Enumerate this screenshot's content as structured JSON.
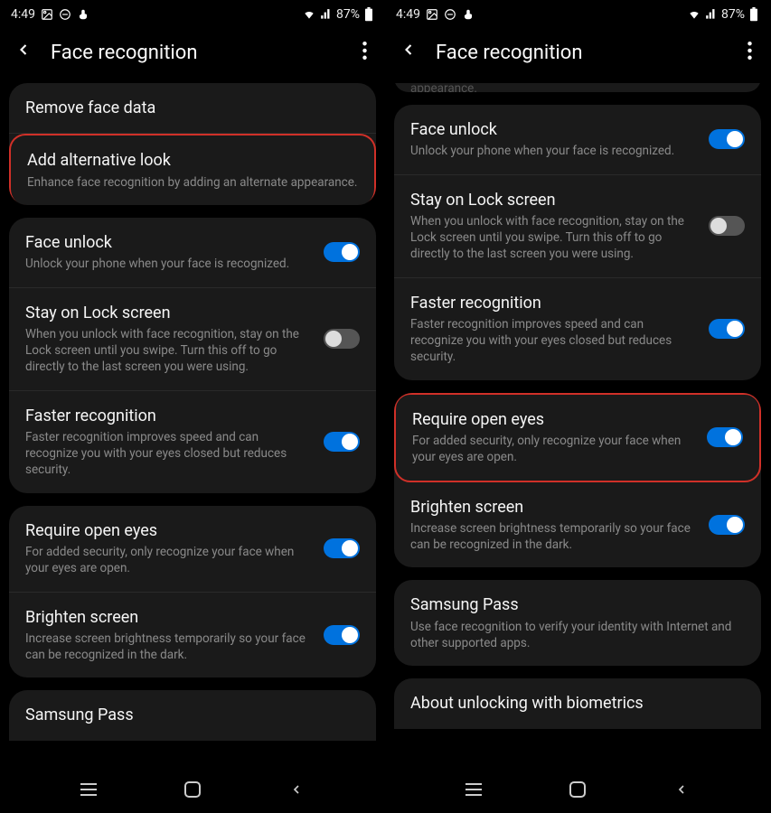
{
  "status": {
    "time": "4:49",
    "battery": "87%"
  },
  "header": {
    "title": "Face recognition"
  },
  "left": {
    "remove_face": "Remove face data",
    "add_alt_title": "Add alternative look",
    "add_alt_desc": "Enhance face recognition by adding an alternate appearance.",
    "face_unlock_title": "Face unlock",
    "face_unlock_desc": "Unlock your phone when your face is recognized.",
    "stay_lock_title": "Stay on Lock screen",
    "stay_lock_desc": "When you unlock with face recognition, stay on the Lock screen until you swipe. Turn this off to go directly to the last screen you were using.",
    "faster_title": "Faster recognition",
    "faster_desc": "Faster recognition improves speed and can recognize you with your eyes closed but reduces security.",
    "open_eyes_title": "Require open eyes",
    "open_eyes_desc": "For added security, only recognize your face when your eyes are open.",
    "brighten_title": "Brighten screen",
    "brighten_desc": "Increase screen brightness temporarily so your face can be recognized in the dark.",
    "samsung_pass_title": "Samsung Pass"
  },
  "right": {
    "face_unlock_title": "Face unlock",
    "face_unlock_desc": "Unlock your phone when your face is recognized.",
    "stay_lock_title": "Stay on Lock screen",
    "stay_lock_desc": "When you unlock with face recognition, stay on the Lock screen until you swipe. Turn this off to go directly to the last screen you were using.",
    "faster_title": "Faster recognition",
    "faster_desc": "Faster recognition improves speed and can recognize you with your eyes closed but reduces security.",
    "open_eyes_title": "Require open eyes",
    "open_eyes_desc": "For added security, only recognize your face when your eyes are open.",
    "brighten_title": "Brighten screen",
    "brighten_desc": "Increase screen brightness temporarily so your face can be recognized in the dark.",
    "samsung_pass_title": "Samsung Pass",
    "samsung_pass_desc": "Use face recognition to verify your identity with Internet and other supported apps.",
    "about_biometrics": "About unlocking with biometrics"
  }
}
